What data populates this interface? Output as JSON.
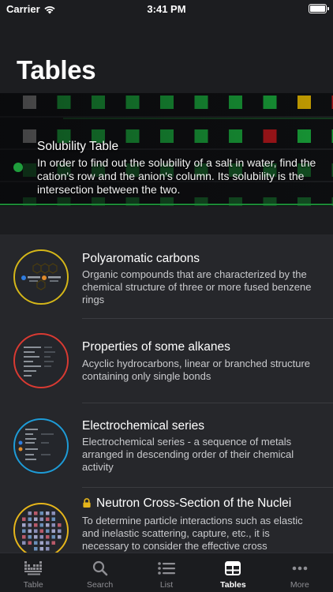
{
  "status_bar": {
    "carrier": "Carrier",
    "time": "3:41 PM"
  },
  "page": {
    "title": "Tables"
  },
  "featured": {
    "title": "Solubility Table",
    "description": "In order to find out the solubility of a salt in water, find the cation's row and the anion's column. Its solubility is the intersection between the two.",
    "colors": {
      "soluble": "#18a53a",
      "insoluble": "#b3161a",
      "slightly": "#d8ae00",
      "unknown": "#8a8a8a"
    }
  },
  "items": [
    {
      "title": "Polyaromatic carbons",
      "description": "Organic compounds that are characterized by the chemical structure of three or more fused benzene rings",
      "icon": "polyaromatic-icon",
      "accent": "#d4b619",
      "locked": false
    },
    {
      "title": "Properties of some alkanes",
      "description": "Acyclic hydrocarbons, linear or branched structure containing only single bonds",
      "icon": "alkanes-icon",
      "accent": "#d83a32",
      "locked": false
    },
    {
      "title": "Electrochemical series",
      "description": "Electrochemical series - a sequence of metals arranged in descending order of their chemical activity",
      "icon": "electrochemical-icon",
      "accent": "#1e9bd6",
      "locked": false
    },
    {
      "title": "Neutron Cross-Section of the Nuclei",
      "description": "To determine particle interactions such as elastic and inelastic scattering, capture, etc., it is necessary to consider the effective cross",
      "icon": "neutron-icon",
      "accent": "#e5b51b",
      "locked": true
    }
  ],
  "tab_bar": {
    "tabs": [
      {
        "label": "Table",
        "icon": "periodic-table-icon",
        "active": false
      },
      {
        "label": "Search",
        "icon": "search-icon",
        "active": false
      },
      {
        "label": "List",
        "icon": "list-icon",
        "active": false
      },
      {
        "label": "Tables",
        "icon": "tables-icon",
        "active": true
      },
      {
        "label": "More",
        "icon": "more-icon",
        "active": false
      }
    ]
  }
}
